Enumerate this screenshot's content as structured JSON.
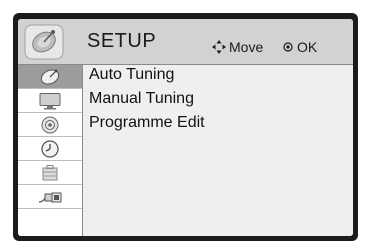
{
  "header": {
    "title": "SETUP",
    "move_hint": "Move",
    "ok_hint": "OK",
    "icon": "satellite-dish-icon"
  },
  "sidebar": {
    "items": [
      {
        "icon": "satellite-dish-icon",
        "active": true
      },
      {
        "icon": "monitor-icon",
        "active": false
      },
      {
        "icon": "speaker-icon",
        "active": false
      },
      {
        "icon": "clock-icon",
        "active": false
      },
      {
        "icon": "lock-icon",
        "active": false
      },
      {
        "icon": "input-cable-icon",
        "active": false
      }
    ]
  },
  "menu": {
    "items": [
      {
        "label": "Auto Tuning"
      },
      {
        "label": "Manual Tuning"
      },
      {
        "label": "Programme Edit"
      }
    ]
  },
  "colors": {
    "frame": "#1c1c1c",
    "header_bg": "#d2d2d2",
    "active_row": "#9c9c9c",
    "content_bg": "#efefef"
  }
}
